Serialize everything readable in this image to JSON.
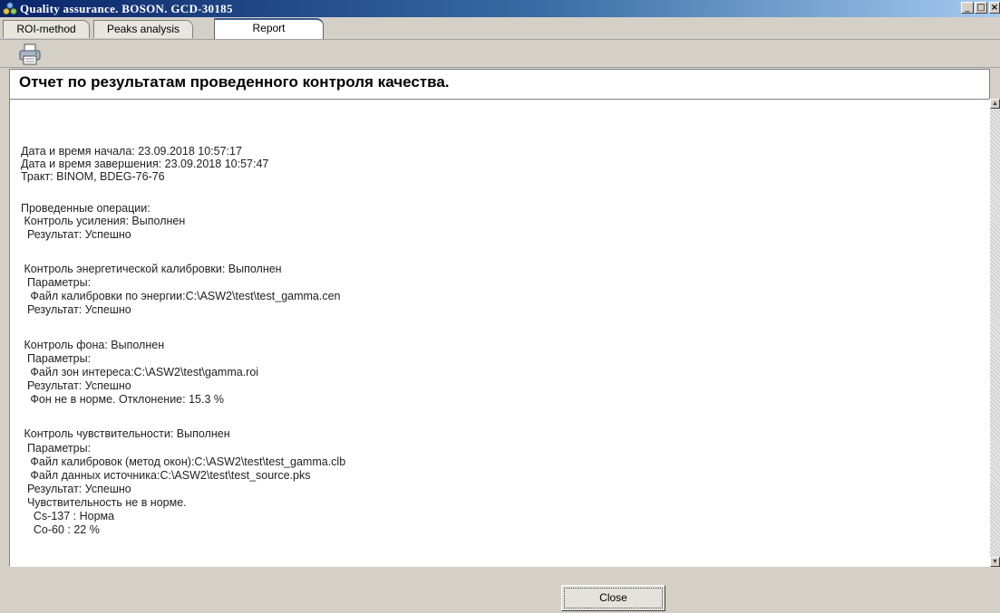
{
  "window": {
    "title": "Quality assurance. BOSON. GCD-30185",
    "minimize_label": "_",
    "maximize_label": "□",
    "close_label": "×"
  },
  "tabs": [
    {
      "label": "ROI-method",
      "active": false
    },
    {
      "label": "Peaks analysis",
      "active": false
    },
    {
      "label": "Report",
      "active": true
    }
  ],
  "toolbar": {
    "print_icon": "printer-icon"
  },
  "report": {
    "title": "Отчет по результатам проведенного контроля качества.",
    "lines": [
      "Дата и время начала: 23.09.2018 10:57:17",
      "Дата и время завершения: 23.09.2018 10:57:47",
      "Тракт: BINOM, BDEG-76-76",
      "Проведенные операции:",
      " Контроль усиления: Выполнен",
      "  Результат: Успешно",
      " Контроль энергетической калибровки: Выполнен",
      "  Параметры:",
      "   Файл калибровки по энергии:C:\\ASW2\\test\\test_gamma.cen",
      "  Результат: Успешно",
      " Контроль фона: Выполнен",
      "  Параметры:",
      "   Файл зон интереса:C:\\ASW2\\test\\gamma.roi",
      "  Результат: Успешно",
      "   Фон не в норме. Отклонение: 15.3 %",
      " Контроль чувствительности: Выполнен",
      "  Параметры:",
      "   Файл калибровок (метод окон):C:\\ASW2\\test\\test_gamma.clb",
      "   Файл данных источника:C:\\ASW2\\test\\test_source.pks",
      "  Результат: Успешно",
      "  Чувствительность не в норме.",
      "    Cs-137 : Норма",
      "    Co-60 : 22 %"
    ]
  },
  "footer": {
    "close_label": "Close"
  },
  "colors": {
    "title_bar_start": "#0a246a",
    "title_bar_end": "#a6caf0",
    "window_bg": "#d4d0c8"
  }
}
